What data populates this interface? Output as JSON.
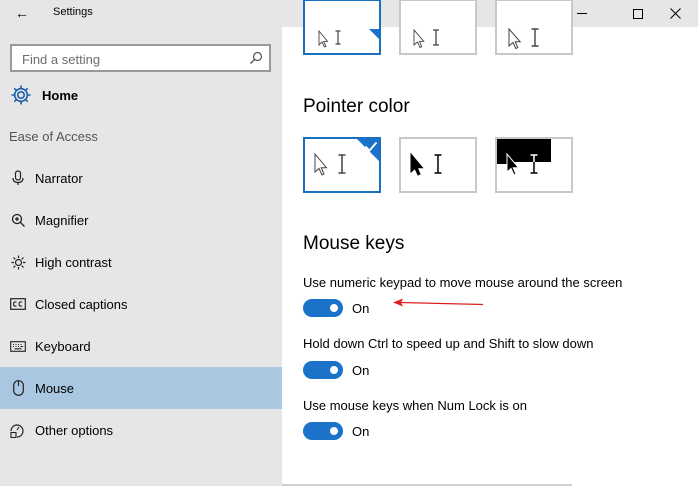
{
  "window": {
    "title": "Settings",
    "back_glyph": "←"
  },
  "sidebar": {
    "search_placeholder": "Find a setting",
    "home_label": "Home",
    "section_label": "Ease of Access",
    "items": [
      {
        "label": "Narrator",
        "icon": "narrator-icon"
      },
      {
        "label": "Magnifier",
        "icon": "magnifier-icon"
      },
      {
        "label": "High contrast",
        "icon": "high-contrast-icon"
      },
      {
        "label": "Closed captions",
        "icon": "closed-captions-icon"
      },
      {
        "label": "Keyboard",
        "icon": "keyboard-icon"
      },
      {
        "label": "Mouse",
        "icon": "mouse-icon",
        "selected": true
      },
      {
        "label": "Other options",
        "icon": "other-options-icon"
      }
    ]
  },
  "main": {
    "pointer_size_selected_index": 0,
    "pointer_color": {
      "heading": "Pointer color",
      "options": [
        "white",
        "black",
        "inverted"
      ],
      "selected_index": 0
    },
    "mouse_keys": {
      "heading": "Mouse keys",
      "settings": [
        {
          "description": "Use numeric keypad to move mouse around the screen",
          "state": "On"
        },
        {
          "description": "Hold down Ctrl to speed up and Shift to slow down",
          "state": "On"
        },
        {
          "description": "Use mouse keys when Num Lock is on",
          "state": "On"
        }
      ]
    }
  },
  "colors": {
    "accent": "#1a73c9",
    "selected_nav": "#a9c7e0",
    "annotation_arrow": "#e02020"
  }
}
